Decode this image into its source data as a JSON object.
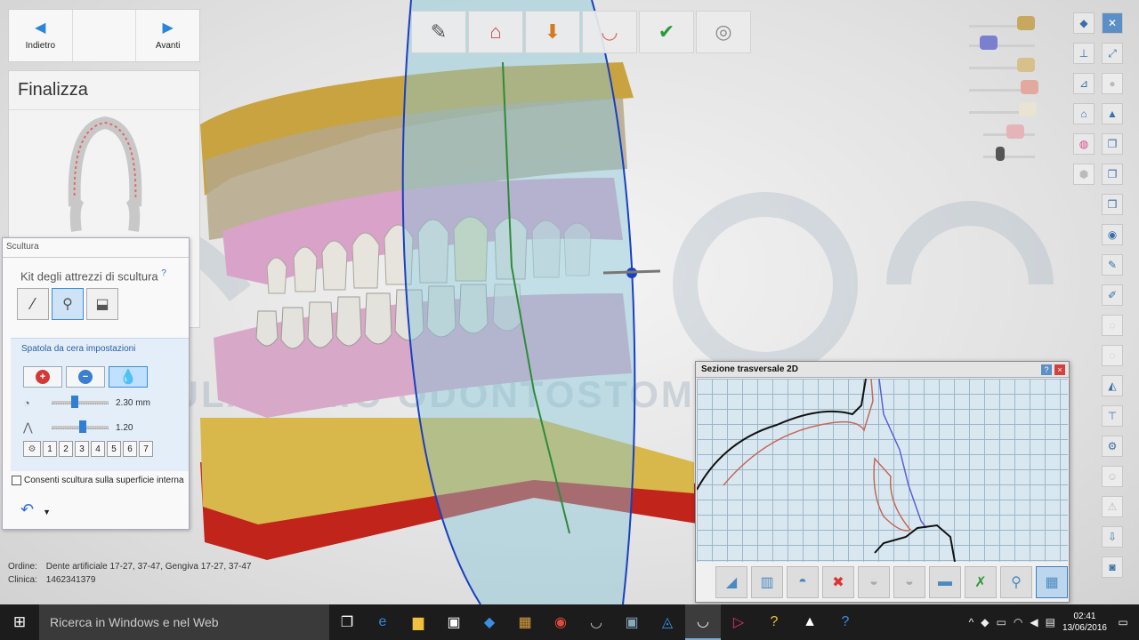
{
  "nav": {
    "back_label": "Indietro",
    "forward_label": "Avanti"
  },
  "step": {
    "title": "Finalizza"
  },
  "sculpt": {
    "window_title": "Scultura",
    "kit_title": "Kit degli attrezzi di scultura",
    "help": "?",
    "settings_label": "Spatola da cera impostazioni",
    "size_value": "2.30 mm",
    "strength_value": "1.20",
    "size_level": 0.4,
    "strength_level": 0.55,
    "numbers": [
      "1",
      "2",
      "3",
      "4",
      "5",
      "6",
      "7"
    ],
    "inner_surface_label": "Consenti scultura sulla superficie interna"
  },
  "order": {
    "order_label": "Ordine:",
    "order_value": "Dente artificiale 17-27, 37-47, Gengiva 17-27, 37-47",
    "clinic_label": "Clinica:",
    "clinic_value": "1462341379"
  },
  "workflow": {
    "steps": [
      {
        "icon": "pencil-icon",
        "glyph": "✎"
      },
      {
        "icon": "arch-icon",
        "glyph": "⌂"
      },
      {
        "icon": "tooth-drop-icon",
        "glyph": "⬇"
      },
      {
        "icon": "gingiva-icon",
        "glyph": "◡"
      },
      {
        "icon": "tooth-check-icon",
        "glyph": "✔"
      },
      {
        "icon": "disc-icon",
        "glyph": "◎"
      }
    ]
  },
  "section": {
    "title": "Sezione trasversale 2D",
    "help": "?",
    "close": "×"
  },
  "watermark": {
    "text": "AMBULATORIO ODONTOSTOMATOLOGICO"
  },
  "taskbar": {
    "search_placeholder": "Ricerca in Windows e nel Web",
    "time": "02:41",
    "date": "13/06/2016"
  },
  "colors": {
    "accent": "#2a86d6",
    "gingiva": "#d9a2c8",
    "model_yellow": "#d8b84a",
    "base_red": "#c0241a",
    "plane": "#87c6d6"
  }
}
